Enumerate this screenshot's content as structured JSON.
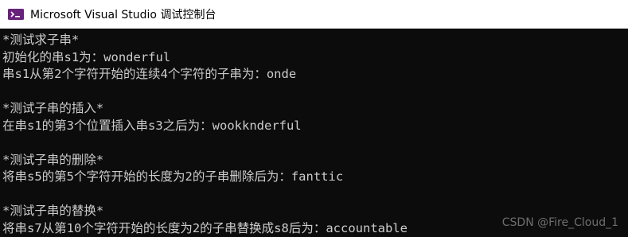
{
  "window": {
    "title": "Microsoft Visual Studio 调试控制台",
    "icon": "visual-studio-icon",
    "accent_color": "#7b3fb3"
  },
  "console": {
    "lines": [
      "*测试求子串*",
      "初始化的串s1为：wonderful",
      "串s1从第2个字符开始的连续4个字符的子串为：onde",
      "",
      "*测试子串的插入*",
      "在串s1的第3个位置插入串s3之后为：wookknderful",
      "",
      "*测试子串的删除*",
      "将串s5的第5个字符开始的长度为2的子串删除后为：fanttic",
      "",
      "*测试子串的替换*",
      "将串s7从第10个字符开始的长度为2的子串替换成s8后为：accountable"
    ]
  },
  "watermark": "CSDN @Fire_Cloud_1"
}
